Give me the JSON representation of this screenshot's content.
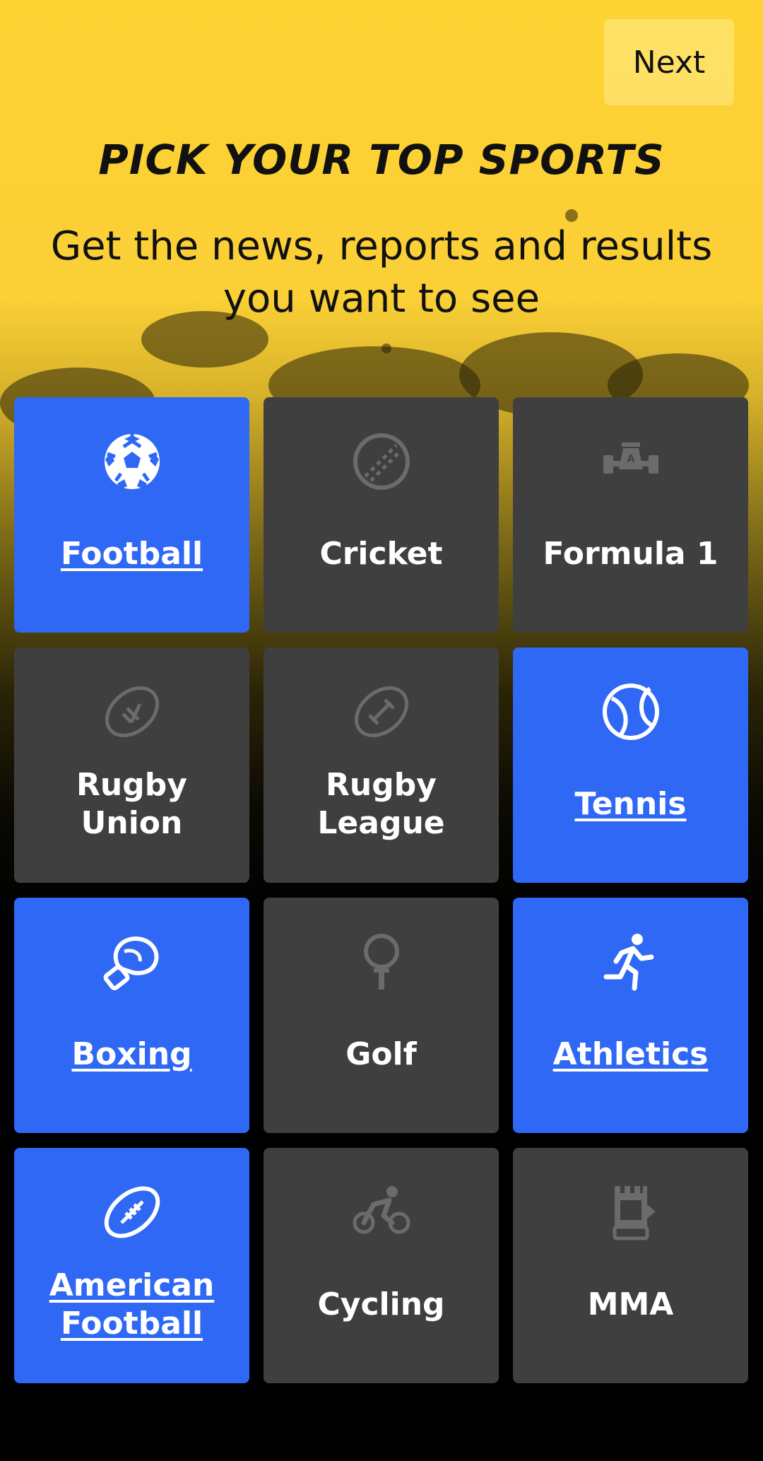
{
  "header": {
    "next_label": "Next",
    "title": "PICK YOUR TOP SPORTS",
    "subtitle": "Get the news, reports and results you want to see"
  },
  "colors": {
    "accent_yellow": "#fdd233",
    "selected_blue": "#2f68f4",
    "tile_grey": "#3f3f3f"
  },
  "sports": [
    {
      "label": "Football",
      "icon": "football-icon",
      "selected": true
    },
    {
      "label": "Cricket",
      "icon": "cricket-ball-icon",
      "selected": false
    },
    {
      "label": "Formula 1",
      "icon": "formula1-car-icon",
      "selected": false
    },
    {
      "label": "Rugby Union",
      "icon": "rugby-union-ball-icon",
      "selected": false
    },
    {
      "label": "Rugby League",
      "icon": "rugby-league-ball-icon",
      "selected": false
    },
    {
      "label": "Tennis",
      "icon": "tennis-ball-icon",
      "selected": true
    },
    {
      "label": "Boxing",
      "icon": "boxing-glove-icon",
      "selected": true
    },
    {
      "label": "Golf",
      "icon": "golf-ball-tee-icon",
      "selected": false
    },
    {
      "label": "Athletics",
      "icon": "runner-icon",
      "selected": true
    },
    {
      "label": "American Football",
      "icon": "american-football-icon",
      "selected": true
    },
    {
      "label": "Cycling",
      "icon": "cyclist-icon",
      "selected": false
    },
    {
      "label": "MMA",
      "icon": "mma-glove-icon",
      "selected": false
    }
  ]
}
